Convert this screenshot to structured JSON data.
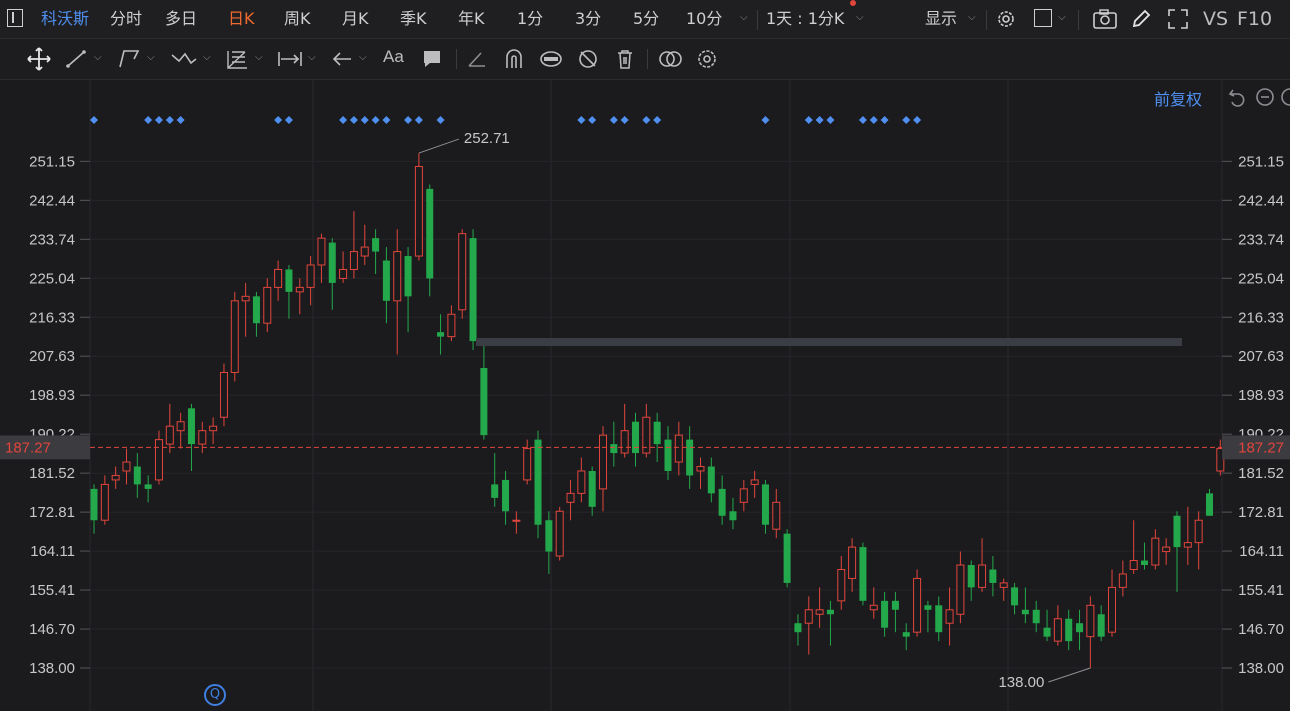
{
  "topbar": {
    "stock_name": "科沃斯",
    "tabs": [
      "分时",
      "多日",
      "日K",
      "周K",
      "月K",
      "季K",
      "年K",
      "1分",
      "3分",
      "5分",
      "10分"
    ],
    "active_tab": "日K",
    "period_selector": "1天 : 1分K",
    "display_label": "显示",
    "vs_label": "VS",
    "f10_label": "F10"
  },
  "drawbar": {
    "font_tool_label": "Aa"
  },
  "chart_header": {
    "adjust_label": "前复权"
  },
  "colors": {
    "up": "#e2453c",
    "down": "#23a94b",
    "last_price": "#e2453c",
    "active_tab": "#f06a2e",
    "accent": "#4f8ff0"
  },
  "chart_data": {
    "type": "candlestick",
    "ylim": [
      133.66,
      257.0
    ],
    "y_ticks": [
      "251.15",
      "242.44",
      "233.74",
      "225.04",
      "216.33",
      "207.63",
      "198.93",
      "190.22",
      "181.52",
      "172.81",
      "164.11",
      "155.41",
      "146.70",
      "138.00"
    ],
    "last_price": "187.27",
    "high_marker": "252.71",
    "low_marker": "138.00",
    "resistance_level": 210.8,
    "candles": [
      {
        "o": 178,
        "c": 171,
        "h": 179,
        "l": 168
      },
      {
        "o": 171,
        "c": 179,
        "h": 181,
        "l": 170
      },
      {
        "o": 180,
        "c": 181,
        "h": 183,
        "l": 178
      },
      {
        "o": 182,
        "c": 184,
        "h": 187,
        "l": 179
      },
      {
        "o": 183,
        "c": 179,
        "h": 186,
        "l": 176
      },
      {
        "o": 179,
        "c": 178,
        "h": 181,
        "l": 175
      },
      {
        "o": 180,
        "c": 189,
        "h": 191,
        "l": 179
      },
      {
        "o": 188,
        "c": 192,
        "h": 197,
        "l": 186
      },
      {
        "o": 191,
        "c": 193,
        "h": 195,
        "l": 187
      },
      {
        "o": 196,
        "c": 188,
        "h": 197,
        "l": 182
      },
      {
        "o": 188,
        "c": 191,
        "h": 193,
        "l": 186
      },
      {
        "o": 191,
        "c": 192,
        "h": 194,
        "l": 188
      },
      {
        "o": 194,
        "c": 204,
        "h": 206,
        "l": 192
      },
      {
        "o": 204,
        "c": 220,
        "h": 222,
        "l": 202
      },
      {
        "o": 220,
        "c": 221,
        "h": 224,
        "l": 212
      },
      {
        "o": 221,
        "c": 215,
        "h": 222,
        "l": 212
      },
      {
        "o": 215,
        "c": 223,
        "h": 225,
        "l": 213
      },
      {
        "o": 223,
        "c": 227,
        "h": 229,
        "l": 220
      },
      {
        "o": 227,
        "c": 222,
        "h": 228,
        "l": 216
      },
      {
        "o": 222,
        "c": 223,
        "h": 225,
        "l": 217
      },
      {
        "o": 223,
        "c": 228,
        "h": 230,
        "l": 219
      },
      {
        "o": 228,
        "c": 234,
        "h": 235,
        "l": 224
      },
      {
        "o": 233,
        "c": 224,
        "h": 234,
        "l": 218
      },
      {
        "o": 225,
        "c": 227,
        "h": 231,
        "l": 224
      },
      {
        "o": 227,
        "c": 231,
        "h": 240,
        "l": 225
      },
      {
        "o": 230,
        "c": 232,
        "h": 237,
        "l": 228
      },
      {
        "o": 234,
        "c": 231,
        "h": 236,
        "l": 226
      },
      {
        "o": 229,
        "c": 220,
        "h": 232,
        "l": 215
      },
      {
        "o": 220,
        "c": 231,
        "h": 236,
        "l": 208
      },
      {
        "o": 230,
        "c": 221,
        "h": 232,
        "l": 213
      },
      {
        "o": 230,
        "c": 250,
        "h": 253,
        "l": 229
      },
      {
        "o": 245,
        "c": 225,
        "h": 246,
        "l": 221
      },
      {
        "o": 213,
        "c": 212,
        "h": 217,
        "l": 208
      },
      {
        "o": 212,
        "c": 217,
        "h": 219,
        "l": 211
      },
      {
        "o": 218,
        "c": 235,
        "h": 236,
        "l": 216
      },
      {
        "o": 234,
        "c": 211,
        "h": 236,
        "l": 209
      },
      {
        "o": 205,
        "c": 190,
        "h": 210,
        "l": 189
      },
      {
        "o": 179,
        "c": 176,
        "h": 186,
        "l": 174
      },
      {
        "o": 180,
        "c": 173,
        "h": 182,
        "l": 170
      },
      {
        "o": 171,
        "c": 171,
        "h": 173,
        "l": 168
      },
      {
        "o": 180,
        "c": 187,
        "h": 189,
        "l": 179
      },
      {
        "o": 189,
        "c": 170,
        "h": 191,
        "l": 167
      },
      {
        "o": 171,
        "c": 164,
        "h": 173,
        "l": 159
      },
      {
        "o": 163,
        "c": 173,
        "h": 174,
        "l": 162
      },
      {
        "o": 175,
        "c": 177,
        "h": 180,
        "l": 171
      },
      {
        "o": 177,
        "c": 182,
        "h": 185,
        "l": 175
      },
      {
        "o": 182,
        "c": 174,
        "h": 183,
        "l": 172
      },
      {
        "o": 178,
        "c": 190,
        "h": 192,
        "l": 173
      },
      {
        "o": 188,
        "c": 186,
        "h": 193,
        "l": 183
      },
      {
        "o": 186,
        "c": 191,
        "h": 197,
        "l": 185
      },
      {
        "o": 193,
        "c": 186,
        "h": 195,
        "l": 183
      },
      {
        "o": 186,
        "c": 194,
        "h": 197,
        "l": 185
      },
      {
        "o": 193,
        "c": 188,
        "h": 195,
        "l": 184
      },
      {
        "o": 189,
        "c": 182,
        "h": 192,
        "l": 180
      },
      {
        "o": 184,
        "c": 190,
        "h": 193,
        "l": 181
      },
      {
        "o": 189,
        "c": 181,
        "h": 192,
        "l": 178
      },
      {
        "o": 182,
        "c": 183,
        "h": 185,
        "l": 178
      },
      {
        "o": 183,
        "c": 177,
        "h": 185,
        "l": 175
      },
      {
        "o": 178,
        "c": 172,
        "h": 181,
        "l": 170
      },
      {
        "o": 173,
        "c": 171,
        "h": 176,
        "l": 169
      },
      {
        "o": 175,
        "c": 178,
        "h": 180,
        "l": 173
      },
      {
        "o": 179,
        "c": 180,
        "h": 182,
        "l": 176
      },
      {
        "o": 179,
        "c": 170,
        "h": 180,
        "l": 168
      },
      {
        "o": 169,
        "c": 175,
        "h": 178,
        "l": 167
      },
      {
        "o": 168,
        "c": 157,
        "h": 169,
        "l": 156
      },
      {
        "o": 148,
        "c": 146,
        "h": 150,
        "l": 143
      },
      {
        "o": 148,
        "c": 151,
        "h": 154,
        "l": 141
      },
      {
        "o": 150,
        "c": 151,
        "h": 156,
        "l": 147
      },
      {
        "o": 151,
        "c": 150,
        "h": 153,
        "l": 143
      },
      {
        "o": 153,
        "c": 160,
        "h": 163,
        "l": 151
      },
      {
        "o": 158,
        "c": 165,
        "h": 167,
        "l": 155
      },
      {
        "o": 165,
        "c": 153,
        "h": 166,
        "l": 152
      },
      {
        "o": 151,
        "c": 152,
        "h": 156,
        "l": 149
      },
      {
        "o": 153,
        "c": 147,
        "h": 155,
        "l": 145
      },
      {
        "o": 153,
        "c": 151,
        "h": 155,
        "l": 146
      },
      {
        "o": 146,
        "c": 145,
        "h": 148,
        "l": 142
      },
      {
        "o": 146,
        "c": 158,
        "h": 160,
        "l": 145
      },
      {
        "o": 152,
        "c": 151,
        "h": 153,
        "l": 146
      },
      {
        "o": 152,
        "c": 146,
        "h": 154,
        "l": 144
      },
      {
        "o": 148,
        "c": 151,
        "h": 156,
        "l": 143
      },
      {
        "o": 150,
        "c": 161,
        "h": 164,
        "l": 148
      },
      {
        "o": 161,
        "c": 156,
        "h": 162,
        "l": 153
      },
      {
        "o": 156,
        "c": 161,
        "h": 167,
        "l": 155
      },
      {
        "o": 160,
        "c": 157,
        "h": 163,
        "l": 154
      },
      {
        "o": 156,
        "c": 157,
        "h": 158,
        "l": 153
      },
      {
        "o": 156,
        "c": 152,
        "h": 157,
        "l": 150
      },
      {
        "o": 151,
        "c": 150,
        "h": 156,
        "l": 148
      },
      {
        "o": 151,
        "c": 148,
        "h": 153,
        "l": 146
      },
      {
        "o": 147,
        "c": 145,
        "h": 151,
        "l": 144
      },
      {
        "o": 144,
        "c": 149,
        "h": 152,
        "l": 143
      },
      {
        "o": 149,
        "c": 144,
        "h": 151,
        "l": 142
      },
      {
        "o": 148,
        "c": 146,
        "h": 151,
        "l": 142
      },
      {
        "o": 145,
        "c": 152,
        "h": 154,
        "l": 138
      },
      {
        "o": 150,
        "c": 145,
        "h": 152,
        "l": 144
      },
      {
        "o": 146,
        "c": 156,
        "h": 160,
        "l": 145
      },
      {
        "o": 156,
        "c": 159,
        "h": 162,
        "l": 154
      },
      {
        "o": 160,
        "c": 162,
        "h": 171,
        "l": 159
      },
      {
        "o": 162,
        "c": 161,
        "h": 166,
        "l": 160
      },
      {
        "o": 161,
        "c": 167,
        "h": 169,
        "l": 160
      },
      {
        "o": 164,
        "c": 165,
        "h": 167,
        "l": 161
      },
      {
        "o": 172,
        "c": 165,
        "h": 173,
        "l": 155
      },
      {
        "o": 165,
        "c": 166,
        "h": 174,
        "l": 161
      },
      {
        "o": 166,
        "c": 171,
        "h": 173,
        "l": 160
      },
      {
        "o": 177,
        "c": 172,
        "h": 178,
        "l": 172
      },
      {
        "o": 182,
        "c": 187,
        "h": 189,
        "l": 181
      }
    ],
    "signal_markers_at": [
      0,
      5,
      6,
      7,
      8,
      17,
      18,
      23,
      24,
      25,
      26,
      27,
      29,
      30,
      32,
      45,
      46,
      48,
      49,
      51,
      52,
      62,
      66,
      67,
      68,
      71,
      72,
      73,
      75,
      76
    ]
  }
}
